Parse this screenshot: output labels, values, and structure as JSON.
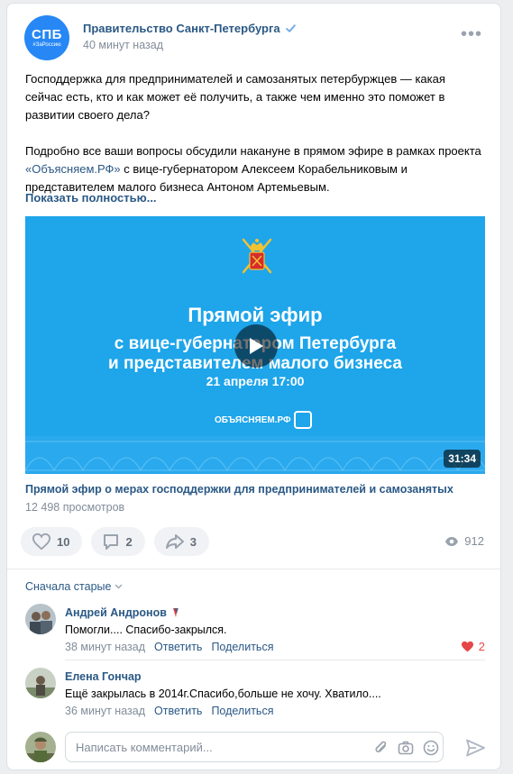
{
  "post": {
    "avatar_big": "СПБ",
    "avatar_small": "#ЗаРоссию",
    "author": "Правительство Санкт-Петербурга",
    "time": "40 минут назад",
    "para1": "Господдержка для предпринимателей и самозанятых петербуржцев — какая сейчас есть, кто и как может её получить, а также чем именно это поможет в развитии своего дела?",
    "para2_before": "Подробно все ваши вопросы обсудили накануне в прямом эфире в рамках проекта ",
    "para2_link": "«Объясняем.РФ»",
    "para2_after": " с вице-губернатором Алексеем Корабельниковым и представителем малого бизнеса Антоном Артемьевым.",
    "show_more": "Показать полностью..."
  },
  "video": {
    "line1": "Прямой эфир",
    "line2a": "с вице-губернатором Петербурга",
    "line2b": "и представителем малого бизнеса",
    "line3": "21 апреля 17:00",
    "brand": "ОБЪЯСНЯЕМ.РФ",
    "duration": "31:34",
    "caption": "Прямой эфир о мерах господдержки для предпринимателей и самозанятых",
    "views": "12 498 просмотров"
  },
  "actions": {
    "likes": "10",
    "comments": "2",
    "shares": "3",
    "views": "912"
  },
  "comments": {
    "sort_label": "Сначала старые",
    "items": [
      {
        "name": "Андрей Андронов",
        "text": "Помогли.... Спасибо-закрылся.",
        "time": "38 минут назад",
        "reply": "Ответить",
        "share": "Поделиться",
        "likes": "2"
      },
      {
        "name": "Елена Гончар",
        "text": "Ещё закрылась в 2014г.Спасибо,больше не хочу. Хватило....",
        "time": "36 минут назад",
        "reply": "Ответить",
        "share": "Поделиться",
        "likes": ""
      }
    ],
    "compose_placeholder": "Написать комментарий..."
  },
  "colors": {
    "accent": "#2a5885",
    "video_bg": "#1ea5ea",
    "like_red": "#e64646",
    "muted": "#818c99"
  },
  "icons": [
    "verified-icon",
    "more-icon",
    "heart-icon",
    "comment-icon",
    "share-icon",
    "eye-icon",
    "play-icon",
    "chevron-down-icon",
    "attach-icon",
    "camera-icon",
    "smile-icon",
    "send-icon"
  ]
}
